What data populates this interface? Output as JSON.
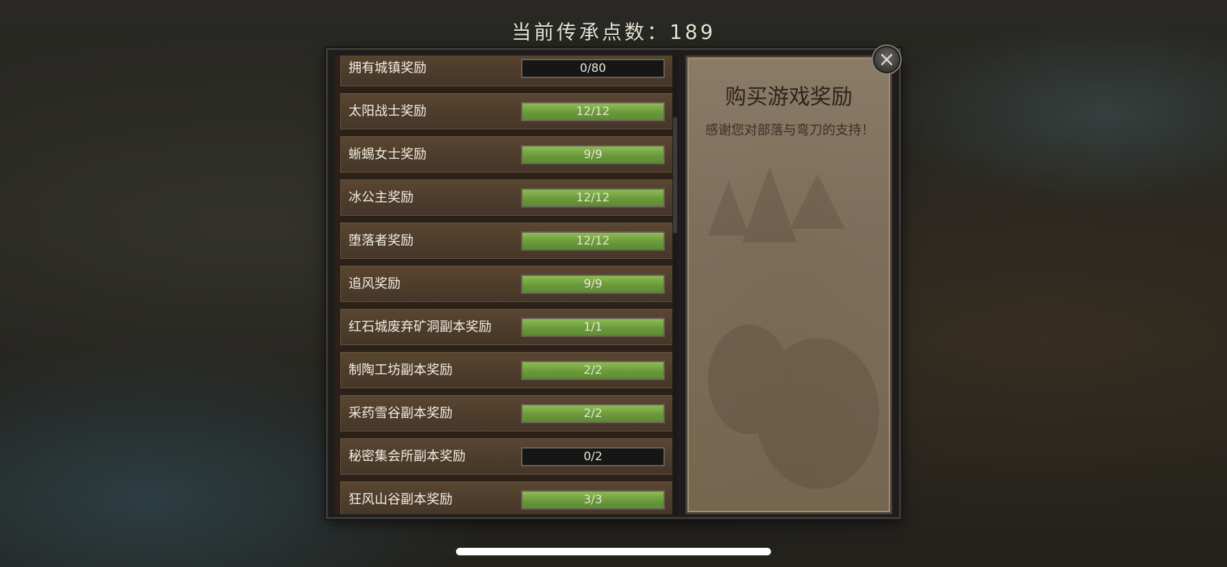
{
  "header": {
    "points_label": "当前传承点数：189"
  },
  "rewards": [
    {
      "label": "拥有城镇奖励",
      "progress": "0/80",
      "fraction": 0
    },
    {
      "label": "太阳战士奖励",
      "progress": "12/12",
      "fraction": 1
    },
    {
      "label": "蜥蜴女士奖励",
      "progress": "9/9",
      "fraction": 1
    },
    {
      "label": "冰公主奖励",
      "progress": "12/12",
      "fraction": 1
    },
    {
      "label": "堕落者奖励",
      "progress": "12/12",
      "fraction": 1
    },
    {
      "label": "追风奖励",
      "progress": "9/9",
      "fraction": 1
    },
    {
      "label": "红石城废弃矿洞副本奖励",
      "progress": "1/1",
      "fraction": 1
    },
    {
      "label": "制陶工坊副本奖励",
      "progress": "2/2",
      "fraction": 1
    },
    {
      "label": "采药雪谷副本奖励",
      "progress": "2/2",
      "fraction": 1
    },
    {
      "label": "秘密集会所副本奖励",
      "progress": "0/2",
      "fraction": 0
    },
    {
      "label": "狂风山谷副本奖励",
      "progress": "3/3",
      "fraction": 1
    }
  ],
  "detail": {
    "title": "购买游戏奖励",
    "description": "感谢您对部落与弯刀的支持！"
  },
  "icons": {
    "close": "close-icon"
  },
  "colors": {
    "progress_fill": "#7aa647",
    "progress_empty": "#161616",
    "row_bg": "#4e3d2b",
    "parchment": "#7d6e5b"
  }
}
